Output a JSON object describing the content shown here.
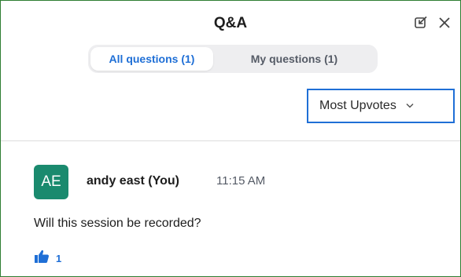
{
  "panel": {
    "title": "Q&A",
    "icons": {
      "popout": "popout-icon",
      "close": "close-icon"
    }
  },
  "tabs": [
    {
      "label": "All questions (1)",
      "active": true
    },
    {
      "label": "My questions (1)",
      "active": false
    }
  ],
  "sort": {
    "selected": "Most Upvotes",
    "icon": "chevron-down-icon"
  },
  "questions": [
    {
      "avatar_initials": "AE",
      "author": "andy east (You)",
      "time": "11:15 AM",
      "text": "Will this session be recorded?",
      "upvotes": "1"
    }
  ],
  "colors": {
    "accent": "#1f6fd6",
    "avatar_bg": "#1a8a6e",
    "frame_border": "#2e7d32"
  }
}
